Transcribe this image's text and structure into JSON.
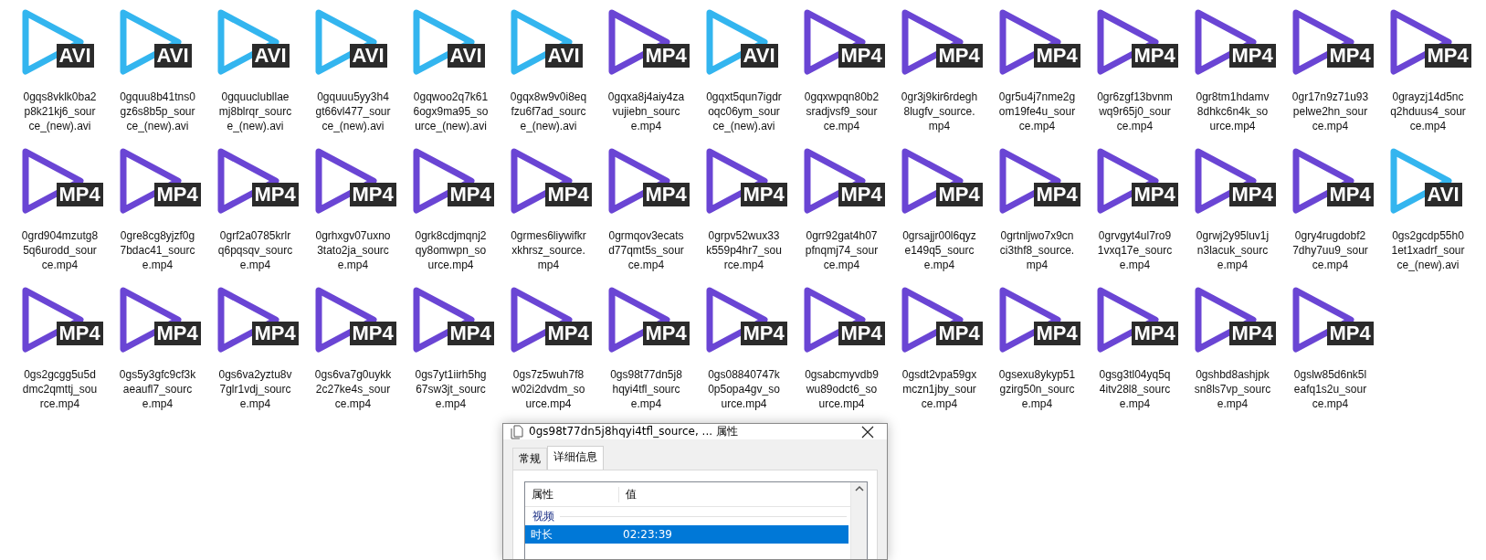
{
  "files": [
    {
      "name": "0gqs8vklk0ba2p8k21kj6_source_(new).avi",
      "kind": "avi",
      "badge": "AVI"
    },
    {
      "name": "0gquu8b41tns0gz6s8b5p_source_(new).avi",
      "kind": "avi",
      "badge": "AVI"
    },
    {
      "name": "0gquuclubllaemj8blrqr_source_(new).avi",
      "kind": "avi",
      "badge": "AVI"
    },
    {
      "name": "0gquuu5yy3h4gt66vl477_source_(new).avi",
      "kind": "avi",
      "badge": "AVI"
    },
    {
      "name": "0gqwoo2q7k616ogx9ma95_source_(new).avi",
      "kind": "avi",
      "badge": "AVI"
    },
    {
      "name": "0gqx8w9v0i8eqfzu6f7ad_source_(new).avi",
      "kind": "avi",
      "badge": "AVI"
    },
    {
      "name": "0gqxa8j4aiy4zavujiebn_source.mp4",
      "kind": "mp4",
      "badge": "MP4"
    },
    {
      "name": "0gqxt5qun7igdroqc06ym_source_(new).avi",
      "kind": "avi",
      "badge": "AVI"
    },
    {
      "name": "0gqxwpqn80b2sradjvsf9_source.mp4",
      "kind": "mp4",
      "badge": "MP4"
    },
    {
      "name": "0gr3j9kir6rdegh8lugfv_source.mp4",
      "kind": "mp4",
      "badge": "MP4"
    },
    {
      "name": "0gr5u4j7nme2gom19fe4u_source.mp4",
      "kind": "mp4",
      "badge": "MP4"
    },
    {
      "name": "0gr6zgf13bvnmwq9r65j0_source.mp4",
      "kind": "mp4",
      "badge": "MP4"
    },
    {
      "name": "0gr8tm1hdamv8dhkc6n4k_source.mp4",
      "kind": "mp4",
      "badge": "MP4"
    },
    {
      "name": "0gr17n9z71u93pelwe2hn_source.mp4",
      "kind": "mp4",
      "badge": "MP4"
    },
    {
      "name": "0grayzj14d5ncq2hduus4_source.mp4",
      "kind": "mp4",
      "badge": "MP4"
    },
    {
      "name": "0grd904mzutg85q6urodd_source.mp4",
      "kind": "mp4",
      "badge": "MP4"
    },
    {
      "name": "0gre8cg8yjzf0g7bdac41_source.mp4",
      "kind": "mp4",
      "badge": "MP4"
    },
    {
      "name": "0grf2a0785krlrq6pqsqv_source.mp4",
      "kind": "mp4",
      "badge": "MP4"
    },
    {
      "name": "0grhxgv07uxno3tato2ja_source.mp4",
      "kind": "mp4",
      "badge": "MP4"
    },
    {
      "name": "0grk8cdjmqnj2qy8omwpn_source.mp4",
      "kind": "mp4",
      "badge": "MP4"
    },
    {
      "name": "0grmes6liywifkrxkhrsz_source.mp4",
      "kind": "mp4",
      "badge": "MP4"
    },
    {
      "name": "0grmqov3ecatsd77qmt5s_source.mp4",
      "kind": "mp4",
      "badge": "MP4"
    },
    {
      "name": "0grpv52wux33k559p4hr7_source.mp4",
      "kind": "mp4",
      "badge": "MP4"
    },
    {
      "name": "0grr92gat4h07pfnqmj74_source.mp4",
      "kind": "mp4",
      "badge": "MP4"
    },
    {
      "name": "0grsajjr00l6qyze149q5_source.mp4",
      "kind": "mp4",
      "badge": "MP4"
    },
    {
      "name": "0grtnljwo7x9cnci3thf8_source.mp4",
      "kind": "mp4",
      "badge": "MP4"
    },
    {
      "name": "0grvgyt4ul7ro91vxq17e_source.mp4",
      "kind": "mp4",
      "badge": "MP4"
    },
    {
      "name": "0grwj2y95luv1jn3lacuk_source.mp4",
      "kind": "mp4",
      "badge": "MP4"
    },
    {
      "name": "0gry4rugdobf27dhy7uu9_source.mp4",
      "kind": "mp4",
      "badge": "MP4"
    },
    {
      "name": "0gs2gcdp55h01et1xadrf_source_(new).avi",
      "kind": "avi",
      "badge": "AVI"
    },
    {
      "name": "0gs2gcgg5u5ddmc2qmttj_source.mp4",
      "kind": "mp4",
      "badge": "MP4"
    },
    {
      "name": "0gs5y3gfc9cf3kaeaufl7_source.mp4",
      "kind": "mp4",
      "badge": "MP4"
    },
    {
      "name": "0gs6va2yztu8v7glr1vdj_source.mp4",
      "kind": "mp4",
      "badge": "MP4"
    },
    {
      "name": "0gs6va7g0uykk2c27ke4s_source.mp4",
      "kind": "mp4",
      "badge": "MP4"
    },
    {
      "name": "0gs7yt1iirh5hg67sw3jt_source.mp4",
      "kind": "mp4",
      "badge": "MP4"
    },
    {
      "name": "0gs7z5wuh7f8w02i2dvdm_source.mp4",
      "kind": "mp4",
      "badge": "MP4"
    },
    {
      "name": "0gs98t77dn5j8hqyi4tfl_source.mp4",
      "kind": "mp4",
      "badge": "MP4"
    },
    {
      "name": "0gs08840747k0p5opa4gv_source.mp4",
      "kind": "mp4",
      "badge": "MP4"
    },
    {
      "name": "0gsabcmyvdb9wu89odct6_source.mp4",
      "kind": "mp4",
      "badge": "MP4"
    },
    {
      "name": "0gsdt2vpa59gxmczn1jby_source.mp4",
      "kind": "mp4",
      "badge": "MP4"
    },
    {
      "name": "0gsexu8ykyp51gzirg50n_source.mp4",
      "kind": "mp4",
      "badge": "MP4"
    },
    {
      "name": "0gsg3tl04yq5q4itv28l8_source.mp4",
      "kind": "mp4",
      "badge": "MP4"
    },
    {
      "name": "0gshbd8ashjpksn8ls7vp_source.mp4",
      "kind": "mp4",
      "badge": "MP4"
    },
    {
      "name": "0gslw85d6nk5leafq1s2u_source.mp4",
      "kind": "mp4",
      "badge": "MP4"
    }
  ],
  "dialog": {
    "title": "0gs98t77dn5j8hqyi4tfl_source, ... 属性",
    "tabs": [
      {
        "label": "常规",
        "selected": false
      },
      {
        "label": "详细信息",
        "selected": true
      }
    ],
    "columns": [
      "属性",
      "值"
    ],
    "group": "视频",
    "rows": [
      {
        "property": "时长",
        "value": "02:23:39",
        "selected": true
      }
    ]
  }
}
